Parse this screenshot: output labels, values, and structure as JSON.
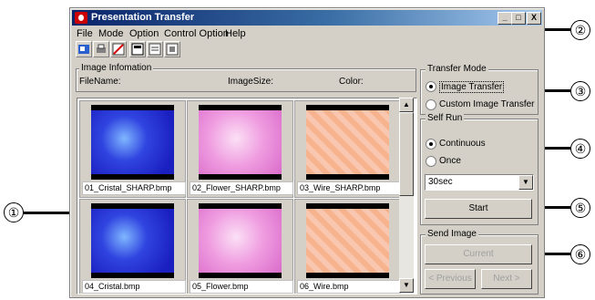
{
  "window": {
    "title": "Presentation Transfer",
    "controls": [
      "_",
      "□",
      "X"
    ]
  },
  "menu": [
    "File",
    "Mode",
    "Option",
    "Control Option",
    "Help"
  ],
  "toolbar_icons": [
    "transfer-icon",
    "print-icon",
    "edit-icon",
    "slide-icon",
    "list-icon",
    "grid-icon"
  ],
  "image_info": {
    "title": "Image Infomation",
    "filename_label": "FileName:",
    "imagesize_label": "ImageSize:",
    "color_label": "Color:"
  },
  "thumbnails": [
    {
      "caption": "01_Cristal_SHARP.bmp",
      "style": "blue"
    },
    {
      "caption": "02_Flower_SHARP.bmp",
      "style": "pink"
    },
    {
      "caption": "03_Wire_SHARP.bmp",
      "style": "orange"
    },
    {
      "caption": "04_Cristal.bmp",
      "style": "blue"
    },
    {
      "caption": "05_Flower.bmp",
      "style": "pink"
    },
    {
      "caption": "06_Wire.bmp",
      "style": "orange"
    }
  ],
  "transfer_mode": {
    "title": "Transfer Mode",
    "options": [
      "Image Transfer",
      "Custom Image Transfer"
    ],
    "selected": 0
  },
  "self_run": {
    "title": "Self Run",
    "options": [
      "Continuous",
      "Once"
    ],
    "selected": 0,
    "interval": "30sec",
    "start_label": "Start"
  },
  "send_image": {
    "title": "Send Image",
    "current_label": "Current",
    "previous_label": "< Previous",
    "next_label": "Next >"
  },
  "callouts": [
    "①",
    "②",
    "③",
    "④",
    "⑤",
    "⑥"
  ]
}
